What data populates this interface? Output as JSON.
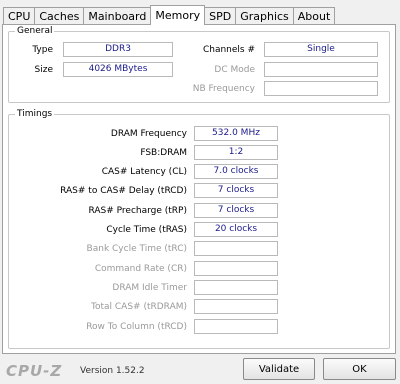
{
  "tabs": [
    "CPU",
    "Caches",
    "Mainboard",
    "Memory",
    "SPD",
    "Graphics",
    "About"
  ],
  "active_tab": "Memory",
  "general": {
    "legend": "General",
    "type_label": "Type",
    "type_value": "DDR3",
    "size_label": "Size",
    "size_value": "4026 MBytes",
    "channels_label": "Channels #",
    "channels_value": "Single",
    "dc_mode_label": "DC Mode",
    "dc_mode_value": "",
    "nb_frequency_label": "NB Frequency",
    "nb_frequency_value": ""
  },
  "timings": {
    "legend": "Timings",
    "rows": [
      {
        "label": "DRAM Frequency",
        "value": "532.0 MHz"
      },
      {
        "label": "FSB:DRAM",
        "value": "1:2"
      },
      {
        "label": "CAS# Latency (CL)",
        "value": "7.0 clocks"
      },
      {
        "label": "RAS# to CAS# Delay (tRCD)",
        "value": "7 clocks"
      },
      {
        "label": "RAS# Precharge (tRP)",
        "value": "7 clocks"
      },
      {
        "label": "Cycle Time (tRAS)",
        "value": "20 clocks"
      },
      {
        "label": "Bank Cycle Time (tRC)",
        "value": ""
      },
      {
        "label": "Command Rate (CR)",
        "value": ""
      },
      {
        "label": "DRAM Idle Timer",
        "value": ""
      },
      {
        "label": "Total CAS# (tRDRAM)",
        "value": ""
      },
      {
        "label": "Row To Column (tRCD)",
        "value": ""
      }
    ]
  },
  "footer": {
    "logo": "CPU-Z",
    "version": "Version 1.52.2",
    "validate_label": "Validate",
    "ok_label": "OK"
  }
}
